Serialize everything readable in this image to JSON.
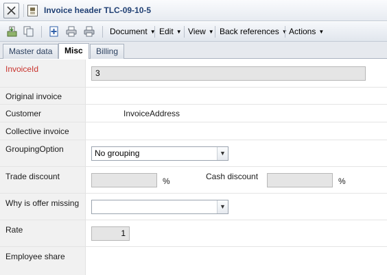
{
  "window": {
    "title": "Invoice header TLC-09-10-5"
  },
  "toolbar": {
    "icons": [
      "new-record-icon",
      "copy-icon",
      "add-page-icon",
      "print-icon",
      "print-preview-icon"
    ],
    "menus": [
      {
        "label": "Document"
      },
      {
        "label": "Edit"
      },
      {
        "label": "View"
      },
      {
        "label": "Back references"
      },
      {
        "label": "Actions"
      }
    ]
  },
  "tabs": [
    {
      "label": "Master data",
      "active": false
    },
    {
      "label": "Misc",
      "active": true
    },
    {
      "label": "Billing",
      "active": false
    }
  ],
  "form": {
    "invoice_id": {
      "label": "InvoiceId",
      "value": "3"
    },
    "original_invoice": {
      "label": "Original invoice"
    },
    "customer": {
      "label": "Customer",
      "value": "InvoiceAddress"
    },
    "collective_invoice": {
      "label": "Collective invoice"
    },
    "grouping_option": {
      "label": "GroupingOption",
      "value": "No grouping"
    },
    "trade_discount": {
      "label": "Trade discount",
      "value": "",
      "unit": "%"
    },
    "cash_discount": {
      "label": "Cash discount",
      "value": "",
      "unit": "%"
    },
    "offer_missing": {
      "label": "Why is offer missing",
      "value": ""
    },
    "rate": {
      "label": "Rate",
      "value": "1"
    },
    "employee_share": {
      "label": "Employee share"
    }
  },
  "colors": {
    "required_label": "#c8312b",
    "title_text": "#1f3f73"
  }
}
